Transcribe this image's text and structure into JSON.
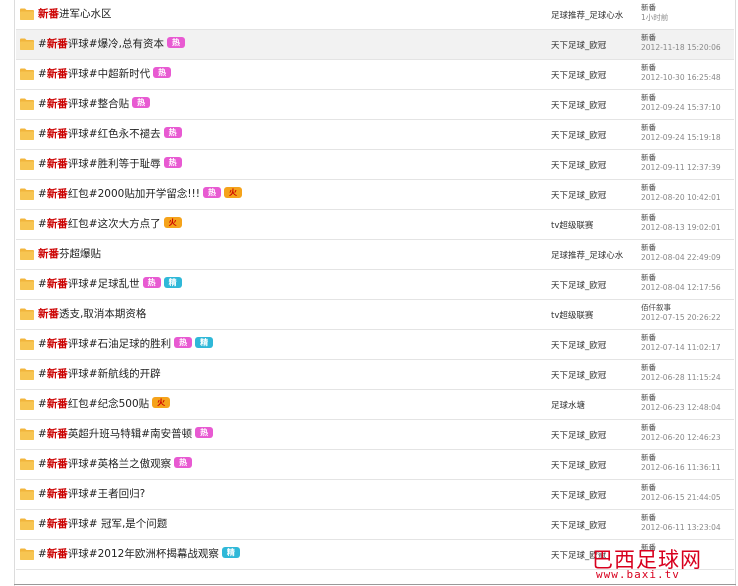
{
  "threads": [
    {
      "tag": "新番",
      "title": "进军心水区",
      "badges": [],
      "forum": "足球推荐_足球心水",
      "author": "新番",
      "time": "1小时前",
      "highlight": false
    },
    {
      "tag": "新番",
      "title": "评球#爆冷,总有资本",
      "prefix": "#",
      "badges": [
        "hot"
      ],
      "forum": "天下足球_欧冠",
      "author": "新番",
      "time": "2012-11-18 15:20:06",
      "highlight": true
    },
    {
      "tag": "新番",
      "title": "评球#中超新时代",
      "prefix": "#",
      "badges": [
        "hot"
      ],
      "forum": "天下足球_欧冠",
      "author": "新番",
      "time": "2012-10-30 16:25:48",
      "highlight": false
    },
    {
      "tag": "新番",
      "title": "评球#整合贴",
      "prefix": "#",
      "badges": [
        "hot"
      ],
      "forum": "天下足球_欧冠",
      "author": "新番",
      "time": "2012-09-24 15:37:10",
      "highlight": false
    },
    {
      "tag": "新番",
      "title": "评球#红色永不褪去",
      "prefix": "#",
      "badges": [
        "hot"
      ],
      "forum": "天下足球_欧冠",
      "author": "新番",
      "time": "2012-09-24 15:19:18",
      "highlight": false
    },
    {
      "tag": "新番",
      "title": "评球#胜利等于耻辱",
      "prefix": "#",
      "badges": [
        "hot"
      ],
      "forum": "天下足球_欧冠",
      "author": "新番",
      "time": "2012-09-11 12:37:39",
      "highlight": false
    },
    {
      "tag": "新番",
      "title": "红包#2000贴加开学留念!!!",
      "prefix": "#",
      "badges": [
        "hot",
        "fire"
      ],
      "forum": "天下足球_欧冠",
      "author": "新番",
      "time": "2012-08-20 10:42:01",
      "highlight": false
    },
    {
      "tag": "新番",
      "title": "红包#这次大方点了",
      "prefix": "#",
      "badges": [
        "fire"
      ],
      "forum": "tv超级联赛",
      "author": "新番",
      "time": "2012-08-13 19:02:01",
      "highlight": false
    },
    {
      "tag": "新番",
      "title": "芬超爆贴",
      "badges": [],
      "forum": "足球推荐_足球心水",
      "author": "新番",
      "time": "2012-08-04 22:49:09",
      "highlight": false
    },
    {
      "tag": "新番",
      "title": "评球#足球乱世",
      "prefix": "#",
      "badges": [
        "hot",
        "jing"
      ],
      "forum": "天下足球_欧冠",
      "author": "新番",
      "time": "2012-08-04 12:17:56",
      "highlight": false
    },
    {
      "tag": "新番",
      "title": "透支,取消本期资格",
      "badges": [],
      "forum": "tv超级联赛",
      "author": "佰仟叙事",
      "time": "2012-07-15 20:26:22",
      "highlight": false
    },
    {
      "tag": "新番",
      "title": "评球#石油足球的胜利",
      "prefix": "#",
      "badges": [
        "hot",
        "jing"
      ],
      "forum": "天下足球_欧冠",
      "author": "新番",
      "time": "2012-07-14 11:02:17",
      "highlight": false
    },
    {
      "tag": "新番",
      "title": "评球#新航线的开辟",
      "prefix": "#",
      "badges": [],
      "forum": "天下足球_欧冠",
      "author": "新番",
      "time": "2012-06-28 11:15:24",
      "highlight": false
    },
    {
      "tag": "新番",
      "title": "红包#纪念500贴",
      "prefix": "#",
      "badges": [
        "fire"
      ],
      "forum": "足球水塘",
      "author": "新番",
      "time": "2012-06-23 12:48:04",
      "highlight": false
    },
    {
      "tag": "新番",
      "title": "英超升班马特辑#南安普顿",
      "prefix": "#",
      "badges": [
        "hot"
      ],
      "forum": "天下足球_欧冠",
      "author": "新番",
      "time": "2012-06-20 12:46:23",
      "highlight": false
    },
    {
      "tag": "新番",
      "title": "评球#英格兰之傲观察",
      "prefix": "#",
      "badges": [
        "hot"
      ],
      "forum": "天下足球_欧冠",
      "author": "新番",
      "time": "2012-06-16 11:36:11",
      "highlight": false
    },
    {
      "tag": "新番",
      "title": "评球#王者回归?",
      "prefix": "#",
      "badges": [],
      "forum": "天下足球_欧冠",
      "author": "新番",
      "time": "2012-06-15 21:44:05",
      "highlight": false
    },
    {
      "tag": "新番",
      "title": "评球# 冠军,是个问题",
      "prefix": "#",
      "badges": [],
      "forum": "天下足球_欧冠",
      "author": "新番",
      "time": "2012-06-11 13:23:04",
      "highlight": false
    },
    {
      "tag": "新番",
      "title": "评球#2012年欧洲杯揭幕战观察",
      "prefix": "#",
      "badges": [
        "jing"
      ],
      "forum": "天下足球_欧冠",
      "author": "新番",
      "time": "",
      "highlight": false
    }
  ],
  "badge_labels": {
    "hot": "热",
    "fire": "火",
    "jing": "精"
  },
  "watermark": {
    "name": "巴西足球网",
    "url": "www.baxi.tv"
  },
  "colors": {
    "tag": "#cc0000",
    "hot": "#e85ad2",
    "fire": "#f5a31b",
    "jing": "#2fb8d8",
    "folder": "#f2b53c"
  }
}
